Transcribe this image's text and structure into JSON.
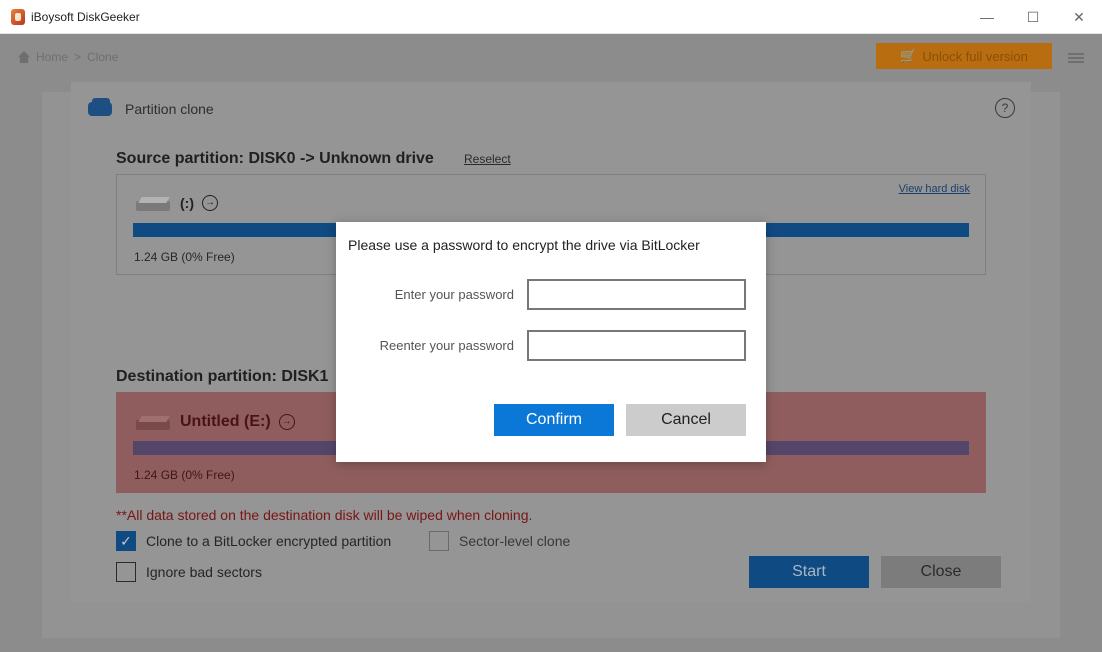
{
  "window": {
    "title": "iBoysoft DiskGeeker",
    "controls": {
      "minimize": "—",
      "maximize": "☐",
      "close": "✕"
    }
  },
  "header": {
    "breadcrumb": [
      "Home",
      ">",
      "Clone"
    ],
    "unlock_label": "Unlock full version"
  },
  "clone_dialog": {
    "title": "Partition clone",
    "help": "?",
    "source": {
      "heading": "Source partition: DISK0 -> Unknown drive",
      "reselect": "Reselect",
      "view_hard_disk": "View hard disk",
      "drive_name": "(:)",
      "usage": "1.24 GB (0% Free)"
    },
    "destination": {
      "heading": "Destination partition: DISK1",
      "drive_name": "Untitled (E:)",
      "usage": "1.24 GB (0% Free)"
    },
    "warning": "**All data stored on the destination disk will be wiped when cloning.",
    "options": {
      "bitlocker": {
        "label": "Clone to a BitLocker encrypted partition",
        "checked": true
      },
      "sector_level": {
        "label": "Sector-level clone",
        "checked": false
      },
      "ignore_bad": {
        "label": "Ignore bad sectors",
        "checked": false
      }
    },
    "start_label": "Start",
    "close_label": "Close"
  },
  "modal": {
    "title": "Please use a password to encrypt the drive via BitLocker",
    "password_label": "Enter your password",
    "password_value": "",
    "reenter_label": "Reenter your password",
    "reenter_value": "",
    "confirm_label": "Confirm",
    "cancel_label": "Cancel"
  },
  "colors": {
    "accent": "#0b78d7",
    "warning": "#d03030",
    "destination_bg": "#f0a0a0"
  }
}
